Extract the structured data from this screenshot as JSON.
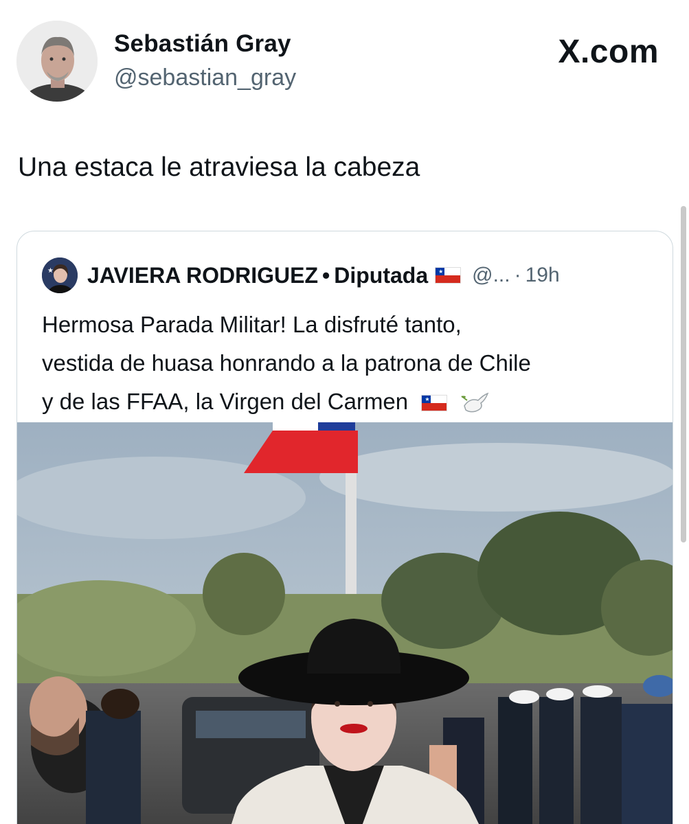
{
  "brand": "X.com",
  "author": {
    "name": "Sebastián Gray",
    "handle": "@sebastian_gray"
  },
  "tweet": {
    "text": "Una estaca le atraviesa la cabeza"
  },
  "quoted": {
    "name": "JAVIERA RODRIGUEZ",
    "separator": "•",
    "role": "Diputada",
    "handle": "@...",
    "time_separator": "·",
    "time": "19h",
    "text_lines": [
      "Hermosa Parada Militar! La disfruté tanto,",
      "vestida de huasa honrando a la patrona de Chile",
      "y de las FFAA, la Virgen del Carmen"
    ],
    "icons": [
      "chile-flag-icon",
      "dove-icon"
    ]
  },
  "colors": {
    "text": "#0f1419",
    "secondary": "#536471",
    "border": "#cfd9de",
    "flag_red": "#d52b1e",
    "flag_blue": "#0039a6"
  }
}
